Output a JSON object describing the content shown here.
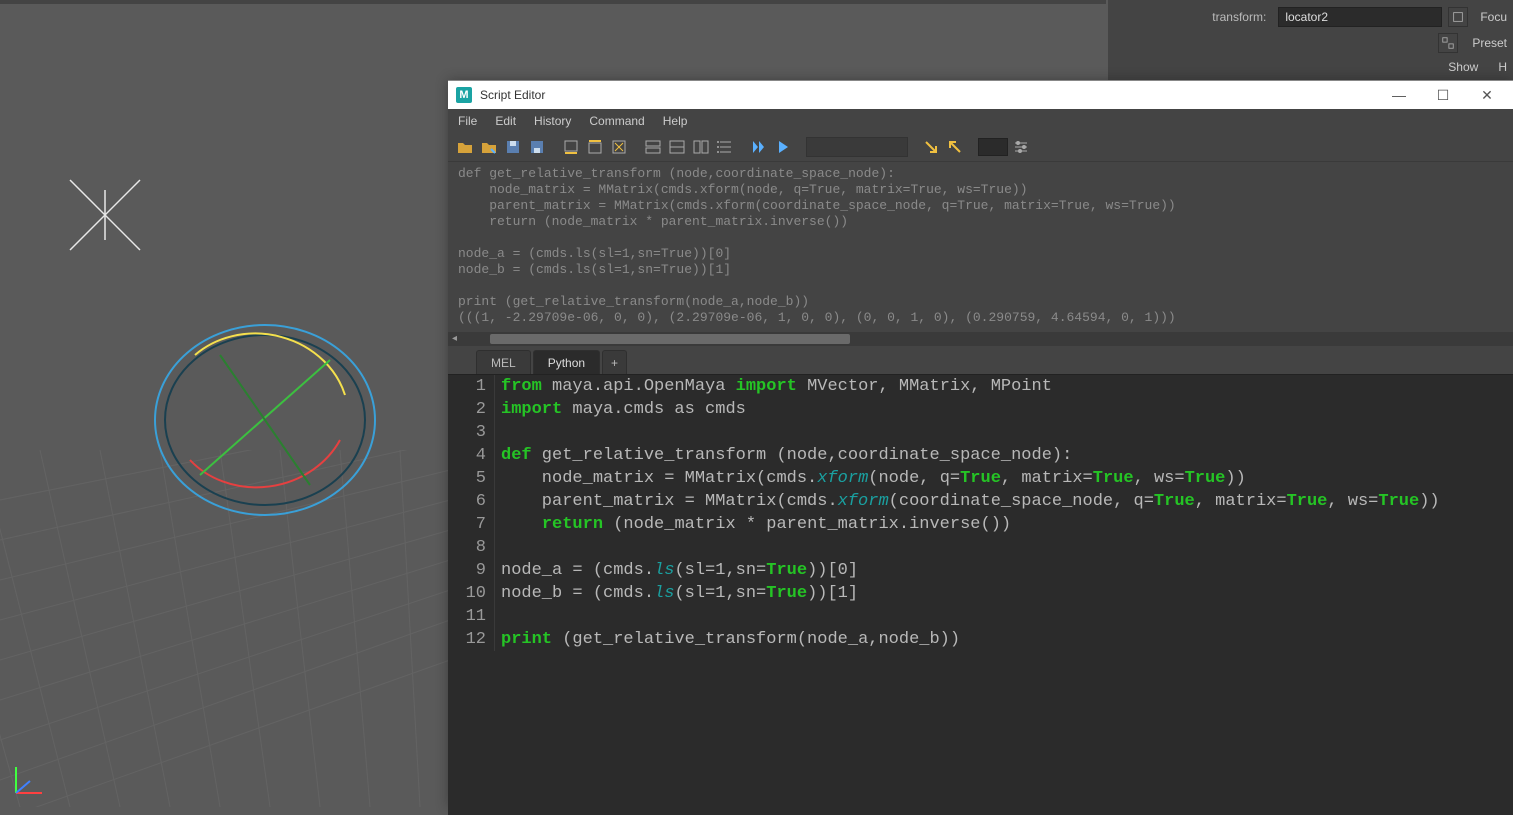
{
  "channel_box": {
    "label": "transform:",
    "value": "locator2",
    "focus_btn": "Focu",
    "preset_btn": "Preset",
    "show_btn": "Show",
    "h_btn": "H"
  },
  "script_editor": {
    "title": "Script Editor",
    "menus": [
      "File",
      "Edit",
      "History",
      "Command",
      "Help"
    ],
    "output": "def get_relative_transform (node,coordinate_space_node):\n    node_matrix = MMatrix(cmds.xform(node, q=True, matrix=True, ws=True))\n    parent_matrix = MMatrix(cmds.xform(coordinate_space_node, q=True, matrix=True, ws=True))\n    return (node_matrix * parent_matrix.inverse())\n\nnode_a = (cmds.ls(sl=1,sn=True))[0]\nnode_b = (cmds.ls(sl=1,sn=True))[1]\n\nprint (get_relative_transform(node_a,node_b))\n(((1, -2.29709e-06, 0, 0), (2.29709e-06, 1, 0, 0), (0, 0, 1, 0), (0.290759, 4.64594, 0, 1)))",
    "tabs": {
      "mel": "MEL",
      "python": "Python",
      "add": "+"
    },
    "code_lines": [
      {
        "n": 1,
        "segs": [
          {
            "t": "from",
            "c": "kw"
          },
          {
            "t": " maya.api.OpenMaya "
          },
          {
            "t": "import",
            "c": "kw"
          },
          {
            "t": " MVector, MMatrix, MPoint"
          }
        ]
      },
      {
        "n": 2,
        "segs": [
          {
            "t": "import",
            "c": "kw"
          },
          {
            "t": " maya.cmds as cmds"
          }
        ]
      },
      {
        "n": 3,
        "segs": [
          {
            "t": ""
          }
        ]
      },
      {
        "n": 4,
        "segs": [
          {
            "t": "def",
            "c": "kw"
          },
          {
            "t": " get_relative_transform (node,coordinate_space_node):"
          }
        ]
      },
      {
        "n": 5,
        "segs": [
          {
            "t": "    node_matrix = MMatrix(cmds."
          },
          {
            "t": "xform",
            "c": "fn"
          },
          {
            "t": "(node, q="
          },
          {
            "t": "True",
            "c": "tru"
          },
          {
            "t": ", matrix="
          },
          {
            "t": "True",
            "c": "tru"
          },
          {
            "t": ", ws="
          },
          {
            "t": "True",
            "c": "tru"
          },
          {
            "t": "))"
          }
        ]
      },
      {
        "n": 6,
        "segs": [
          {
            "t": "    parent_matrix = MMatrix(cmds."
          },
          {
            "t": "xform",
            "c": "fn"
          },
          {
            "t": "(coordinate_space_node, q="
          },
          {
            "t": "True",
            "c": "tru"
          },
          {
            "t": ", matrix="
          },
          {
            "t": "True",
            "c": "tru"
          },
          {
            "t": ", ws="
          },
          {
            "t": "True",
            "c": "tru"
          },
          {
            "t": "))"
          }
        ]
      },
      {
        "n": 7,
        "segs": [
          {
            "t": "    "
          },
          {
            "t": "return",
            "c": "kw"
          },
          {
            "t": " (node_matrix * parent_matrix.inverse())"
          }
        ]
      },
      {
        "n": 8,
        "segs": [
          {
            "t": ""
          }
        ]
      },
      {
        "n": 9,
        "segs": [
          {
            "t": "node_a = (cmds."
          },
          {
            "t": "ls",
            "c": "fn"
          },
          {
            "t": "(sl=1,sn="
          },
          {
            "t": "True",
            "c": "tru"
          },
          {
            "t": "))[0]"
          }
        ]
      },
      {
        "n": 10,
        "segs": [
          {
            "t": "node_b = (cmds."
          },
          {
            "t": "ls",
            "c": "fn"
          },
          {
            "t": "(sl=1,sn="
          },
          {
            "t": "True",
            "c": "tru"
          },
          {
            "t": "))[1]"
          }
        ]
      },
      {
        "n": 11,
        "segs": [
          {
            "t": ""
          }
        ]
      },
      {
        "n": 12,
        "segs": [
          {
            "t": "print",
            "c": "kw"
          },
          {
            "t": " (get_relative_transform(node_a,node_b))"
          }
        ]
      }
    ]
  }
}
